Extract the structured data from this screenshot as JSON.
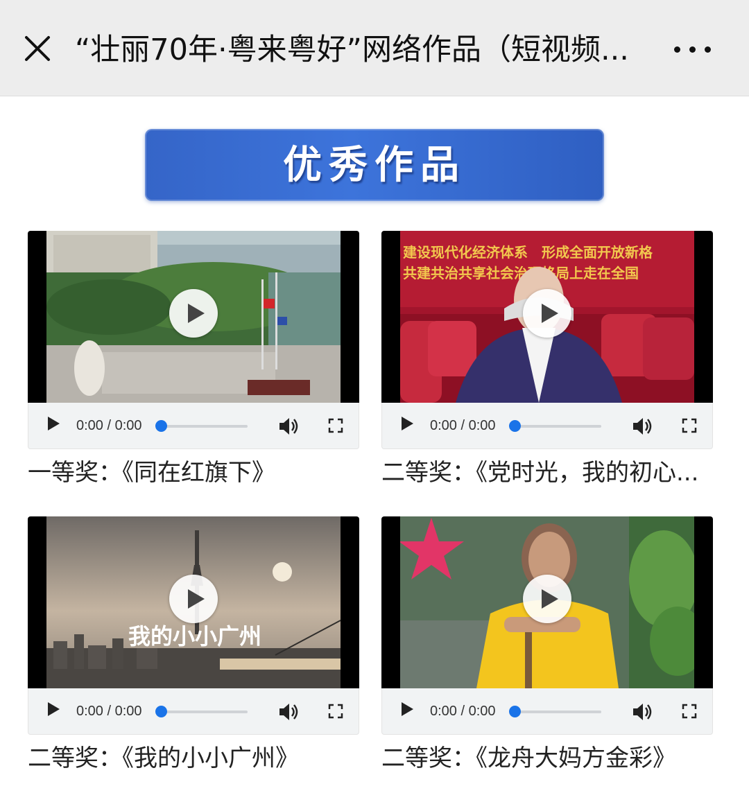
{
  "header": {
    "title": "“壮丽70年·粤来粤好”网络作品（短视频...",
    "close_icon": "close-icon",
    "more_icon": "more-dots-icon"
  },
  "banner": {
    "text": "优秀作品"
  },
  "videos": [
    {
      "caption": "一等奖：《同在红旗下》",
      "time": "0:00 / 0:00",
      "progress": 0
    },
    {
      "caption": "二等奖：《党时光，我的初心...",
      "time": "0:00 / 0:00",
      "progress": 0,
      "frame_text": [
        "建设现代化经济体系　形成全面开放新格",
        "共建共治共享社会治理格局上走在全国"
      ]
    },
    {
      "caption": "二等奖：《我的小小广州》",
      "time": "0:00 / 0:00",
      "progress": 0,
      "frame_text": "我的小小广州"
    },
    {
      "caption": "二等奖：《龙舟大妈方金彩》",
      "time": "0:00 / 0:00",
      "progress": 0
    }
  ],
  "colors": {
    "accent": "#1a73e8",
    "banner": "#3a6fd6",
    "header_bg": "#ededed"
  }
}
